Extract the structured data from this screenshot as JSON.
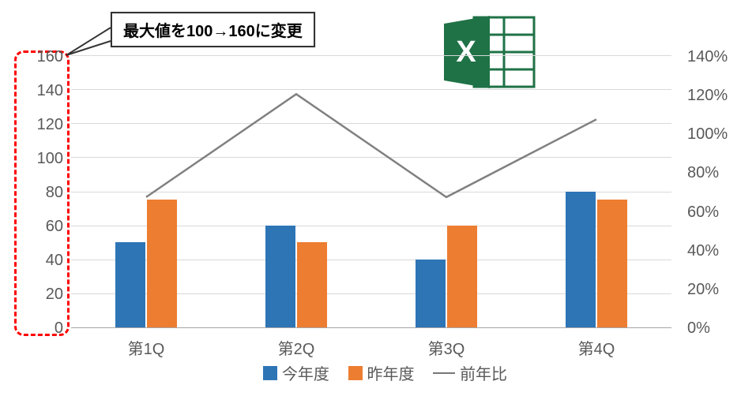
{
  "chart_data": {
    "type": "bar",
    "categories": [
      "第1Q",
      "第2Q",
      "第3Q",
      "第4Q"
    ],
    "series": [
      {
        "name": "今年度",
        "values": [
          50,
          60,
          40,
          80
        ],
        "color": "#2e75b6",
        "chart": "bar",
        "axis": "primary"
      },
      {
        "name": "昨年度",
        "values": [
          75,
          50,
          60,
          75
        ],
        "color": "#ed7d31",
        "chart": "bar",
        "axis": "primary"
      },
      {
        "name": "前年比",
        "values": [
          67,
          120,
          67,
          107
        ],
        "color": "#808080",
        "chart": "line",
        "axis": "secondary",
        "unit": "%"
      }
    ],
    "y_primary": {
      "min": 0,
      "max": 160,
      "step": 20,
      "ticks": [
        "0",
        "20",
        "40",
        "60",
        "80",
        "100",
        "120",
        "140",
        "160"
      ]
    },
    "y_secondary": {
      "min": 0,
      "max": 140,
      "step": 20,
      "ticks": [
        "0%",
        "20%",
        "40%",
        "60%",
        "80%",
        "100%",
        "120%",
        "140%"
      ]
    },
    "title": ""
  },
  "callout_text": "最大値を100→160に変更",
  "legend": {
    "s1": "今年度",
    "s2": "昨年度",
    "s3": "前年比"
  },
  "icons": {
    "excel": "excel-icon"
  }
}
